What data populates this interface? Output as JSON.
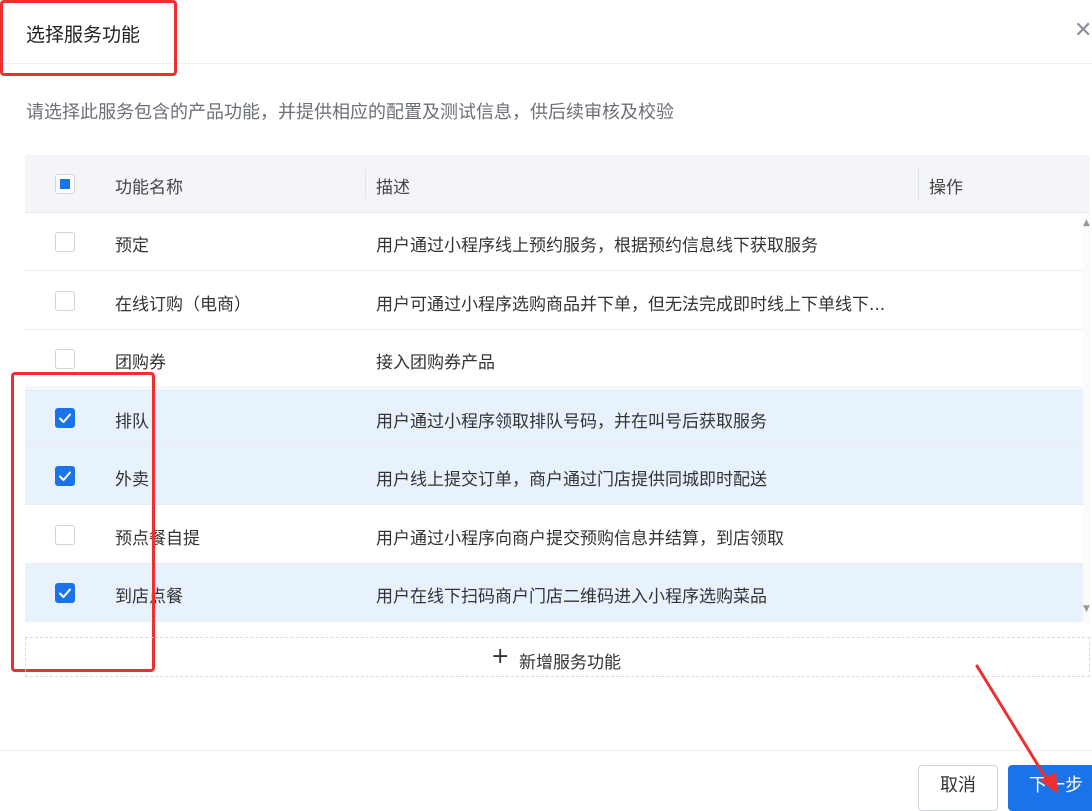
{
  "dialog": {
    "title": "选择服务功能",
    "close_icon": "close-icon",
    "intro": "请选择此服务包含的产品功能，并提供相应的配置及测试信息，供后续审核及校验"
  },
  "table": {
    "headers": {
      "name": "功能名称",
      "desc": "描述",
      "action": "操作"
    },
    "header_checkbox": "indeterminate",
    "rows": [
      {
        "name": "预定",
        "desc": "用户通过小程序线上预约服务，根据预约信息线下获取服务",
        "checked": false
      },
      {
        "name": "在线订购（电商）",
        "desc": "用户可通过小程序选购商品并下单，但无法完成即时线上下单线下...",
        "checked": false
      },
      {
        "name": "团购券",
        "desc": "接入团购券产品",
        "checked": false
      },
      {
        "name": "排队",
        "desc": "用户通过小程序领取排队号码，并在叫号后获取服务",
        "checked": true
      },
      {
        "name": "外卖",
        "desc": "用户线上提交订单，商户通过门店提供同城即时配送",
        "checked": true
      },
      {
        "name": "预点餐自提",
        "desc": "用户通过小程序向商户提交预购信息并结算，到店领取",
        "checked": false
      },
      {
        "name": "到店点餐",
        "desc": "用户在线下扫码商户门店二维码进入小程序选购菜品",
        "checked": true
      }
    ]
  },
  "add_button": {
    "icon": "plus-icon",
    "label": "新增服务功能"
  },
  "footer": {
    "cancel_label": "取消",
    "next_label": "下一步"
  },
  "colors": {
    "primary": "#1a73e8",
    "selected_row": "#e7f2fc",
    "annotation": "#ef2f2f"
  }
}
